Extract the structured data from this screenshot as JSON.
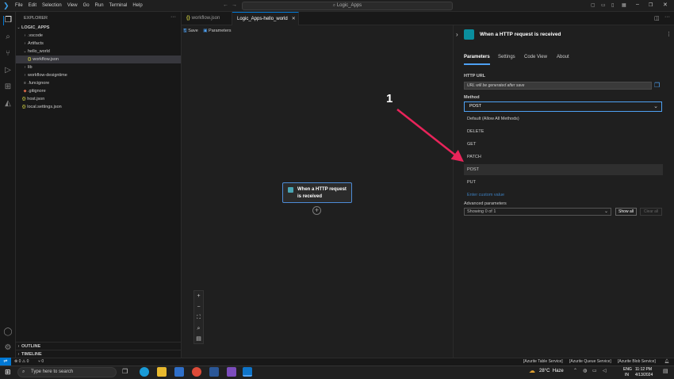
{
  "window": {
    "menu": [
      "File",
      "Edit",
      "Selection",
      "View",
      "Go",
      "Run",
      "Terminal",
      "Help"
    ],
    "search_text": "Logic_Apps"
  },
  "sidebar": {
    "title": "EXPLORER",
    "root": "LOGIC_APPS",
    "items": [
      {
        "label": ".vscode",
        "type": "folder"
      },
      {
        "label": "Artifacts",
        "type": "folder"
      },
      {
        "label": "hello_world",
        "type": "folder-open"
      },
      {
        "label": "workflow.json",
        "type": "json"
      },
      {
        "label": "lib",
        "type": "folder"
      },
      {
        "label": "workflow-designtime",
        "type": "folder"
      },
      {
        "label": ".funcignore",
        "type": "file"
      },
      {
        "label": ".gitignore",
        "type": "file"
      },
      {
        "label": "host.json",
        "type": "json"
      },
      {
        "label": "local.settings.json",
        "type": "json"
      }
    ],
    "outline": "OUTLINE",
    "timeline": "TIMELINE"
  },
  "tabs": [
    {
      "label": "workflow.json"
    },
    {
      "label": "Logic_Apps-hello_world"
    }
  ],
  "editor": {
    "save_label": "Save",
    "parameters_label": "Parameters",
    "trigger_label": "When a HTTP request is received",
    "zoom_in": "+",
    "zoom_out": "−",
    "fit": "⛶",
    "search": "⌕",
    "map": "▤"
  },
  "panel": {
    "title": "When a HTTP request is received",
    "tabs": [
      "Parameters",
      "Settings",
      "Code View",
      "About"
    ],
    "http_url_label": "HTTP URL",
    "http_url_value": "URL will be generated after save",
    "method_label": "Method",
    "method_value": "POST",
    "method_options": [
      "Default (Allow All Methods)",
      "DELETE",
      "GET",
      "PATCH",
      "POST",
      "PUT"
    ],
    "custom_value": "Enter custom value",
    "advanced_label": "Advanced parameters",
    "advanced_value": "Showing 0 of 1",
    "show_all": "Show all",
    "clear_all": "Clear all"
  },
  "annotation": {
    "number": "1",
    "color": "#e8245a"
  },
  "statusbar": {
    "problems": "⊗ 0 ⚠ 0",
    "ports": "⑂ 0",
    "azurite_table": "[Azurite Table Service]",
    "azurite_queue": "[Azurite Queue Service]",
    "azurite_blob": "[Azurite Blob Service]"
  },
  "taskbar": {
    "search_placeholder": "Type here to search",
    "weather": "28°C  Haze",
    "lang": "ENG",
    "region": "IN",
    "time": "11:12 PM",
    "date": "4/13/2024"
  }
}
